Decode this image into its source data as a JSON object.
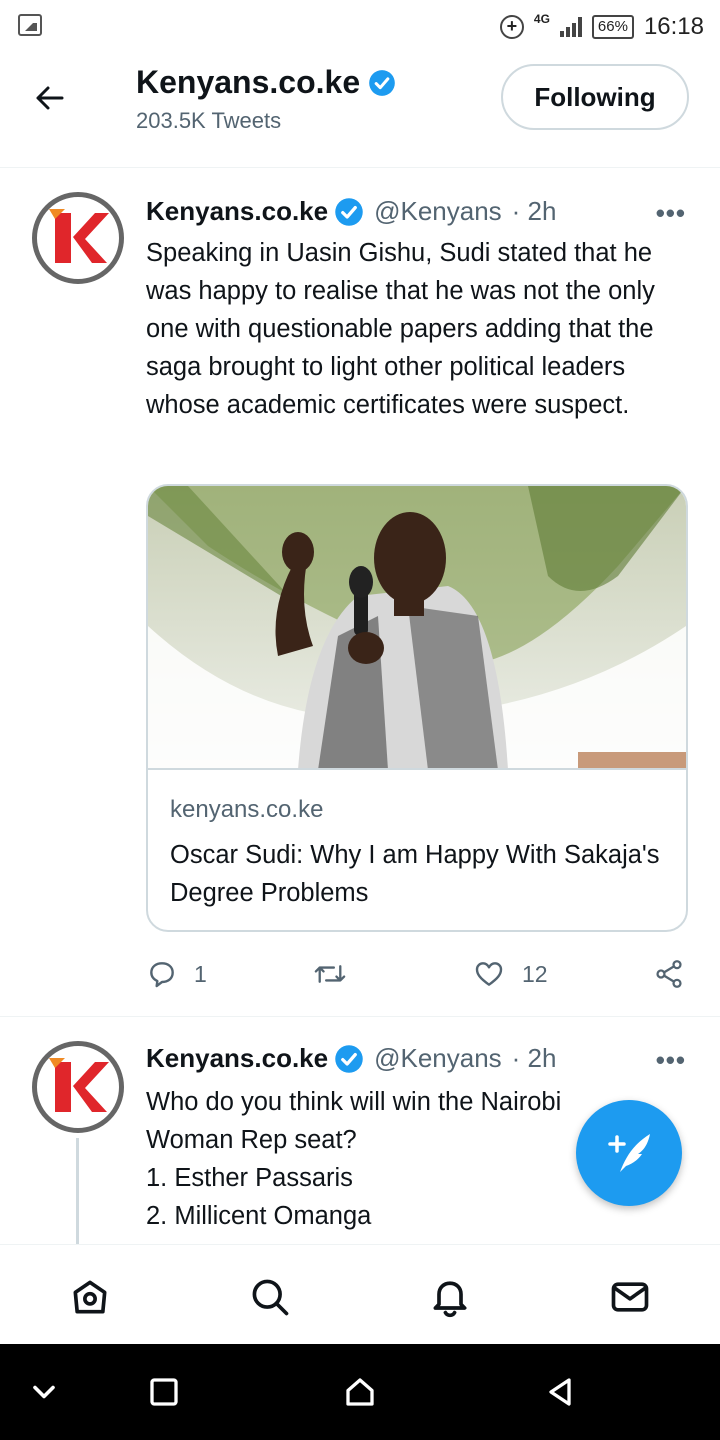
{
  "status_bar": {
    "network": "4G",
    "battery": "66%",
    "time": "16:18"
  },
  "header": {
    "title": "Kenyans.co.ke",
    "subtitle": "203.5K Tweets",
    "follow_label": "Following"
  },
  "tweets": [
    {
      "name": "Kenyans.co.ke",
      "handle": "@Kenyans",
      "time": "· 2h",
      "more": "•••",
      "text": "Speaking in Uasin Gishu, Sudi stated that he was happy to realise that he was not the only one with questionable papers adding that the saga brought to light other political leaders whose academic certificates were suspect.",
      "card": {
        "domain": "kenyans.co.ke",
        "title": "Oscar Sudi: Why I am Happy With Sakaja's Degree Problems"
      },
      "replies": "1",
      "retweets": "",
      "likes": "12"
    },
    {
      "name": "Kenyans.co.ke",
      "handle": "@Kenyans",
      "time": "· 2h",
      "more": "•••",
      "lines": [
        "Who do you think will win the Nairobi",
        "Woman Rep seat?",
        "1. Esther Passaris",
        "2. Millicent Omanga"
      ]
    }
  ],
  "colors": {
    "accent": "#1d9bf0",
    "text_primary": "#0f1419",
    "text_secondary": "#536471",
    "border": "#cfd9de",
    "logo_red": "#e0262b",
    "logo_orange": "#f08a24"
  },
  "icons": {
    "back": "arrow-left-icon",
    "verified": "verified-badge-icon",
    "reply": "reply-icon",
    "retweet": "retweet-icon",
    "like": "heart-icon",
    "share": "share-icon",
    "compose": "compose-tweet-icon",
    "nav": [
      "home-icon",
      "search-icon",
      "notifications-icon",
      "messages-icon"
    ],
    "system": [
      "chevron-down-icon",
      "recents-icon",
      "home-system-icon",
      "back-system-icon"
    ]
  }
}
